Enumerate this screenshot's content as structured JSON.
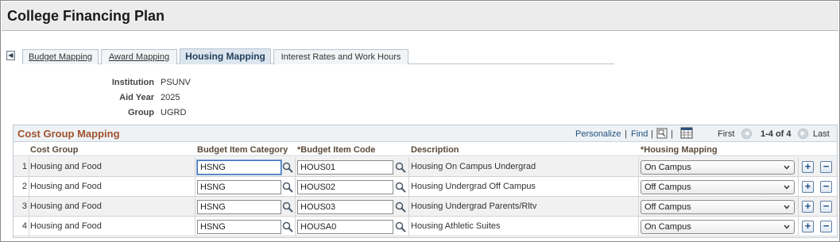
{
  "page": {
    "title": "College Financing Plan"
  },
  "tabs": [
    {
      "label": "Budget Mapping",
      "active": false
    },
    {
      "label": "Award Mapping",
      "active": false
    },
    {
      "label": "Housing Mapping",
      "active": true
    },
    {
      "label": "Interest Rates and Work Hours",
      "active": false
    }
  ],
  "info": {
    "institution_label": "Institution",
    "institution_value": "PSUNV",
    "aid_year_label": "Aid Year",
    "aid_year_value": "2025",
    "group_label": "Group",
    "group_value": "UGRD"
  },
  "grid": {
    "title": "Cost Group Mapping",
    "personalize": "Personalize",
    "sep1": "|",
    "find": "Find",
    "sep2": "|",
    "sep3": "|",
    "first": "First",
    "range": "1-4 of 4",
    "last": "Last",
    "columns": {
      "cost_group": "Cost Group",
      "budget_item_category": "Budget Item Category",
      "budget_item_code": "*Budget Item Code",
      "description": "Description",
      "housing_mapping": "*Housing Mapping"
    },
    "rows": [
      {
        "num": "1",
        "cost_group": "Housing and Food",
        "category": "HSNG",
        "code": "HOUS01",
        "description": "Housing On Campus Undergrad",
        "mapping": "On Campus"
      },
      {
        "num": "2",
        "cost_group": "Housing and Food",
        "category": "HSNG",
        "code": "HOUS02",
        "description": "Housing Undergrad Off Campus",
        "mapping": "Off Campus"
      },
      {
        "num": "3",
        "cost_group": "Housing and Food",
        "category": "HSNG",
        "code": "HOUS03",
        "description": "Housing Undergrad Parents/Rltv",
        "mapping": "Off Campus"
      },
      {
        "num": "4",
        "cost_group": "Housing and Food",
        "category": "HSNG",
        "code": "HOUSA0",
        "description": "Housing Athletic Suites",
        "mapping": "On Campus"
      }
    ],
    "add_symbol": "+",
    "remove_symbol": "−"
  },
  "icons": {
    "tab_scroll": "chevron-left-icon",
    "lookup": "search-icon",
    "view_all": "spreadsheet-icon",
    "zoom": "zoom-icon",
    "first_arrow": "chevron-left-icon",
    "last_arrow": "chevron-right-icon",
    "dropdown": "chevron-down-icon"
  },
  "colors": {
    "grid_title": "#a0522d",
    "link": "#1e4f7c",
    "active_tab": "#dde6ee",
    "odd_row": "#f1f1f1"
  }
}
